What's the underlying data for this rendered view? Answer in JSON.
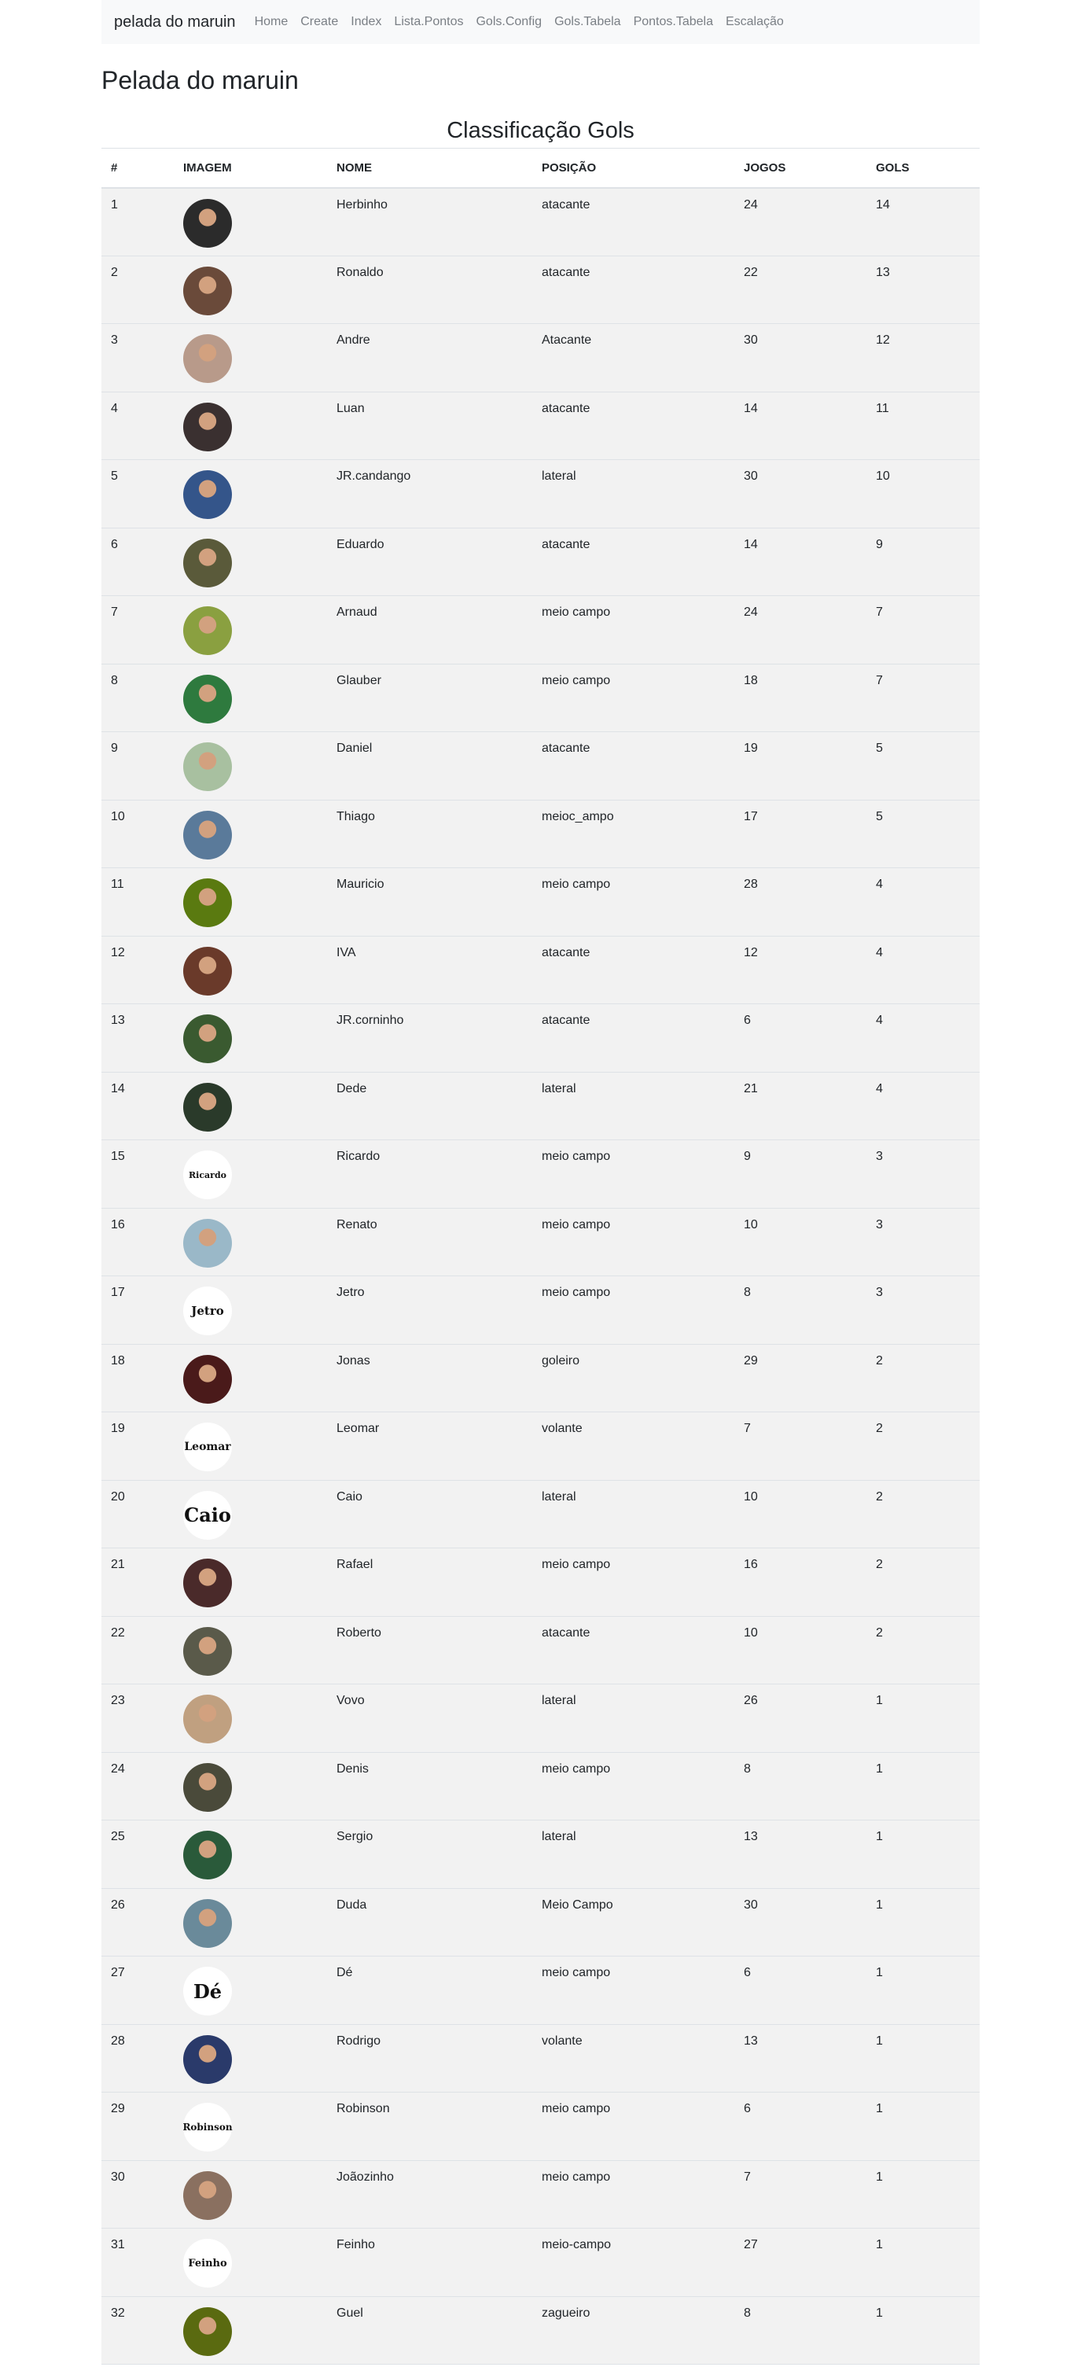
{
  "navbar": {
    "brand": "pelada do maruin",
    "links": [
      "Home",
      "Create",
      "Index",
      "Lista.Pontos",
      "Gols.Config",
      "Gols.Tabela",
      "Pontos.Tabela",
      "Escalação"
    ]
  },
  "page_title": "Pelada do maruin",
  "table_title": "Classificação Gols",
  "columns": [
    "#",
    "IMAGEM",
    "NOME",
    "POSIÇÃO",
    "JOGOS",
    "GOLS"
  ],
  "rows": [
    {
      "rank": "1",
      "name": "Herbinho",
      "position": "atacante",
      "games": "24",
      "goals": "14",
      "avatar": "photo",
      "avatar_color": "#2b2b2b"
    },
    {
      "rank": "2",
      "name": "Ronaldo",
      "position": "atacante",
      "games": "22",
      "goals": "13",
      "avatar": "photo",
      "avatar_color": "#6a4a3a"
    },
    {
      "rank": "3",
      "name": "Andre",
      "position": "Atacante",
      "games": "30",
      "goals": "12",
      "avatar": "photo",
      "avatar_color": "#b89a8a"
    },
    {
      "rank": "4",
      "name": "Luan",
      "position": "atacante",
      "games": "14",
      "goals": "11",
      "avatar": "photo",
      "avatar_color": "#3a3030"
    },
    {
      "rank": "5",
      "name": "JR.candango",
      "position": "lateral",
      "games": "30",
      "goals": "10",
      "avatar": "photo",
      "avatar_color": "#34558a"
    },
    {
      "rank": "6",
      "name": "Eduardo",
      "position": "atacante",
      "games": "14",
      "goals": "9",
      "avatar": "photo",
      "avatar_color": "#5a5a3a"
    },
    {
      "rank": "7",
      "name": "Arnaud",
      "position": "meio campo",
      "games": "24",
      "goals": "7",
      "avatar": "photo",
      "avatar_color": "#8aa040"
    },
    {
      "rank": "8",
      "name": "Glauber",
      "position": "meio campo",
      "games": "18",
      "goals": "7",
      "avatar": "photo",
      "avatar_color": "#2e7a3e"
    },
    {
      "rank": "9",
      "name": "Daniel",
      "position": "atacante",
      "games": "19",
      "goals": "5",
      "avatar": "photo",
      "avatar_color": "#a8c0a0"
    },
    {
      "rank": "10",
      "name": "Thiago",
      "position": "meioc_ampo",
      "games": "17",
      "goals": "5",
      "avatar": "photo",
      "avatar_color": "#5a7a9a"
    },
    {
      "rank": "11",
      "name": "Mauricio",
      "position": "meio campo",
      "games": "28",
      "goals": "4",
      "avatar": "photo",
      "avatar_color": "#5a7a10"
    },
    {
      "rank": "12",
      "name": "IVA",
      "position": "atacante",
      "games": "12",
      "goals": "4",
      "avatar": "photo",
      "avatar_color": "#6a3a2a"
    },
    {
      "rank": "13",
      "name": "JR.corninho",
      "position": "atacante",
      "games": "6",
      "goals": "4",
      "avatar": "photo",
      "avatar_color": "#3a5a30"
    },
    {
      "rank": "14",
      "name": "Dede",
      "position": "lateral",
      "games": "21",
      "goals": "4",
      "avatar": "photo",
      "avatar_color": "#2a3a2a"
    },
    {
      "rank": "15",
      "name": "Ricardo",
      "position": "meio campo",
      "games": "9",
      "goals": "3",
      "avatar": "text",
      "avatar_text": "Ricardo",
      "avatar_font": "11px"
    },
    {
      "rank": "16",
      "name": "Renato",
      "position": "meio campo",
      "games": "10",
      "goals": "3",
      "avatar": "photo",
      "avatar_color": "#9ab8c8"
    },
    {
      "rank": "17",
      "name": "Jetro",
      "position": "meio campo",
      "games": "8",
      "goals": "3",
      "avatar": "text",
      "avatar_text": "Jetro",
      "avatar_font": "15px"
    },
    {
      "rank": "18",
      "name": "Jonas",
      "position": "goleiro",
      "games": "29",
      "goals": "2",
      "avatar": "photo",
      "avatar_color": "#4a1a1a"
    },
    {
      "rank": "19",
      "name": "Leomar",
      "position": "volante",
      "games": "7",
      "goals": "2",
      "avatar": "text",
      "avatar_text": "Leomar",
      "avatar_font": "14px"
    },
    {
      "rank": "20",
      "name": "Caio",
      "position": "lateral",
      "games": "10",
      "goals": "2",
      "avatar": "text",
      "avatar_text": "Caio",
      "avatar_font": "24px"
    },
    {
      "rank": "21",
      "name": "Rafael",
      "position": "meio campo",
      "games": "16",
      "goals": "2",
      "avatar": "photo",
      "avatar_color": "#4a2a2a"
    },
    {
      "rank": "22",
      "name": "Roberto",
      "position": "atacante",
      "games": "10",
      "goals": "2",
      "avatar": "photo",
      "avatar_color": "#5a5a4a"
    },
    {
      "rank": "23",
      "name": "Vovo",
      "position": "lateral",
      "games": "26",
      "goals": "1",
      "avatar": "photo",
      "avatar_color": "#c0a080"
    },
    {
      "rank": "24",
      "name": "Denis",
      "position": "meio campo",
      "games": "8",
      "goals": "1",
      "avatar": "photo",
      "avatar_color": "#4a4a3a"
    },
    {
      "rank": "25",
      "name": "Sergio",
      "position": "lateral",
      "games": "13",
      "goals": "1",
      "avatar": "photo",
      "avatar_color": "#2a5a3a"
    },
    {
      "rank": "26",
      "name": "Duda",
      "position": "Meio Campo",
      "games": "30",
      "goals": "1",
      "avatar": "photo",
      "avatar_color": "#6a8a9a"
    },
    {
      "rank": "27",
      "name": "Dé",
      "position": "meio campo",
      "games": "6",
      "goals": "1",
      "avatar": "text",
      "avatar_text": "Dé",
      "avatar_font": "24px"
    },
    {
      "rank": "28",
      "name": "Rodrigo",
      "position": "volante",
      "games": "13",
      "goals": "1",
      "avatar": "photo",
      "avatar_color": "#2a3a6a"
    },
    {
      "rank": "29",
      "name": "Robinson",
      "position": "meio campo",
      "games": "6",
      "goals": "1",
      "avatar": "text",
      "avatar_text": "Robinson",
      "avatar_font": "12px"
    },
    {
      "rank": "30",
      "name": "Joãozinho",
      "position": "meio campo",
      "games": "7",
      "goals": "1",
      "avatar": "photo",
      "avatar_color": "#8a7060"
    },
    {
      "rank": "31",
      "name": "Feinho",
      "position": "meio-campo",
      "games": "27",
      "goals": "1",
      "avatar": "text",
      "avatar_text": "Feinho",
      "avatar_font": "13px"
    },
    {
      "rank": "32",
      "name": "Guel",
      "position": "zagueiro",
      "games": "8",
      "goals": "1",
      "avatar": "photo",
      "avatar_color": "#5a6a10"
    }
  ]
}
